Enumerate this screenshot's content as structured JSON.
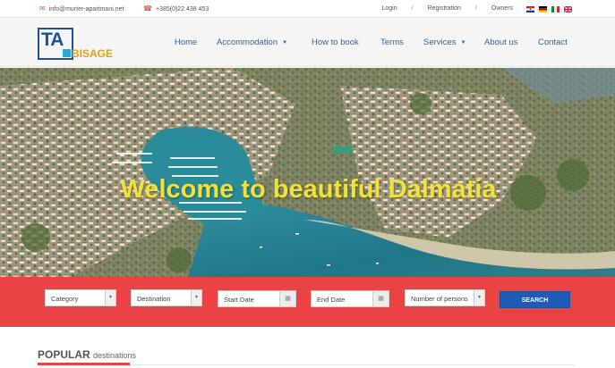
{
  "topbar": {
    "email": "info@murter-apartmani.net",
    "phone": "+385(0)22 438 453",
    "links": [
      "Login",
      "Registration",
      "Owners"
    ],
    "email_icon": "envelope-icon",
    "phone_icon": "phone-icon",
    "flags": [
      "flag-croatia",
      "flag-germany",
      "flag-italy",
      "flag-uk"
    ]
  },
  "logo": {
    "text": "TA",
    "subtext": "BISAGE"
  },
  "nav": {
    "items": [
      {
        "label": "Home",
        "dropdown": false
      },
      {
        "label": "Accommodation",
        "dropdown": true
      },
      {
        "label": "How to book",
        "dropdown": false
      },
      {
        "label": "Terms",
        "dropdown": false
      },
      {
        "label": "Services",
        "dropdown": true
      },
      {
        "label": "About us",
        "dropdown": false
      },
      {
        "label": "Contact",
        "dropdown": false
      }
    ]
  },
  "hero": {
    "title": "Welcome to beautiful Dalmatia"
  },
  "search": {
    "category": "Category",
    "destination": "Destination",
    "start_date": "Start Date",
    "end_date": "End Date",
    "persons": "Number of persons",
    "button": "SEARCH"
  },
  "popular": {
    "title_bold": "POPULAR",
    "title_rest": "destinations"
  },
  "colors": {
    "accent_red": "#e94343",
    "brand_blue": "#1f5bb5",
    "nav_text": "#33619a",
    "hero_title": "#f0e23a"
  }
}
